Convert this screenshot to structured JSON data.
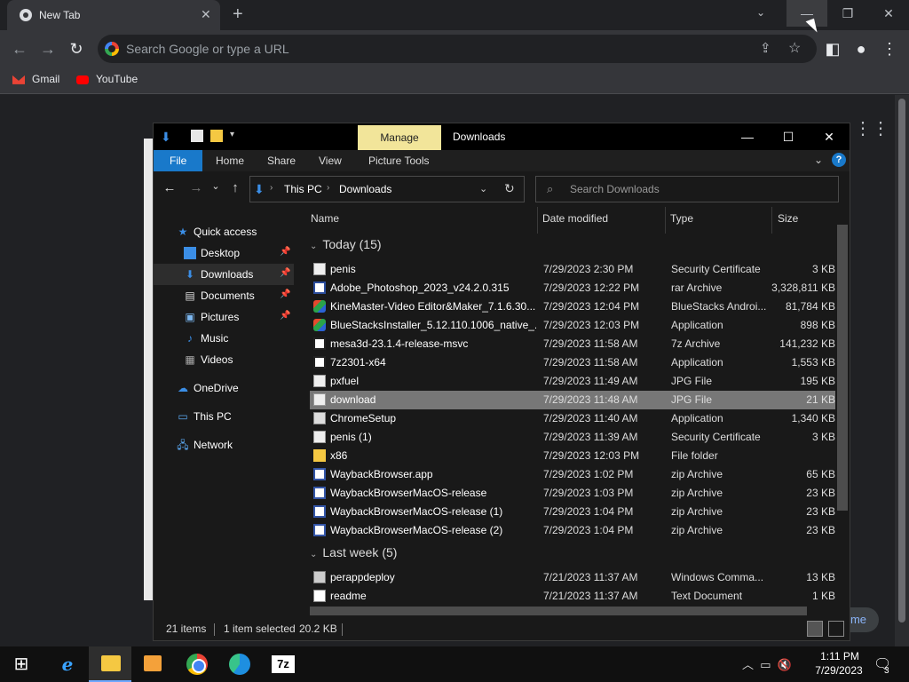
{
  "chrome": {
    "tab_title": "New Tab",
    "new_tab_symbol": "+",
    "omnibox_placeholder": "Search Google or type a URL",
    "bookmarks": [
      {
        "label": "Gmail",
        "icon": "gmail-icon"
      },
      {
        "label": "YouTube",
        "icon": "youtube-icon"
      }
    ],
    "ghost_pill_text": "me"
  },
  "explorer": {
    "title": "Downloads",
    "manage_tab": "Manage",
    "ribbon_tabs": [
      "File",
      "Home",
      "Share",
      "View",
      "Picture Tools"
    ],
    "breadcrumb": [
      "This PC",
      "Downloads"
    ],
    "search_placeholder": "Search Downloads",
    "nav": [
      {
        "label": "Quick access",
        "icon": "star-icon",
        "pinned": false
      },
      {
        "label": "Desktop",
        "icon": "desktop-icon",
        "pinned": true
      },
      {
        "label": "Downloads",
        "icon": "download-arrow-icon",
        "pinned": true,
        "selected": true
      },
      {
        "label": "Documents",
        "icon": "document-icon",
        "pinned": true
      },
      {
        "label": "Pictures",
        "icon": "picture-icon",
        "pinned": true
      },
      {
        "label": "Music",
        "icon": "music-icon",
        "pinned": false
      },
      {
        "label": "Videos",
        "icon": "video-icon",
        "pinned": false
      },
      {
        "label": "OneDrive",
        "icon": "cloud-icon",
        "pinned": false
      },
      {
        "label": "This PC",
        "icon": "computer-icon",
        "pinned": false
      },
      {
        "label": "Network",
        "icon": "network-icon",
        "pinned": false
      }
    ],
    "columns": [
      "Name",
      "Date modified",
      "Type",
      "Size"
    ],
    "groups": [
      {
        "label": "Today (15)",
        "files": [
          {
            "name": "penis",
            "date": "7/29/2023 2:30 PM",
            "type": "Security Certificate",
            "size": "3 KB",
            "icon": "cert"
          },
          {
            "name": "Adobe_Photoshop_2023_v24.2.0.315",
            "date": "7/29/2023 12:22 PM",
            "type": "rar Archive",
            "size": "3,328,811 KB",
            "icon": "rar"
          },
          {
            "name": "KineMaster-Video Editor&Maker_7.1.6.30...",
            "date": "7/29/2023 12:04 PM",
            "type": "BlueStacks Androi...",
            "size": "81,784 KB",
            "icon": "app"
          },
          {
            "name": "BlueStacksInstaller_5.12.110.1006_native_...",
            "date": "7/29/2023 12:03 PM",
            "type": "Application",
            "size": "898 KB",
            "icon": "app"
          },
          {
            "name": "mesa3d-23.1.4-release-msvc",
            "date": "7/29/2023 11:58 AM",
            "type": "7z Archive",
            "size": "141,232 KB",
            "icon": "7z"
          },
          {
            "name": "7z2301-x64",
            "date": "7/29/2023 11:58 AM",
            "type": "Application",
            "size": "1,553 KB",
            "icon": "7z"
          },
          {
            "name": "pxfuel",
            "date": "7/29/2023 11:49 AM",
            "type": "JPG File",
            "size": "195 KB",
            "icon": "jpg"
          },
          {
            "name": "download",
            "date": "7/29/2023 11:48 AM",
            "type": "JPG File",
            "size": "21 KB",
            "icon": "jpg",
            "selected": true
          },
          {
            "name": "ChromeSetup",
            "date": "7/29/2023 11:40 AM",
            "type": "Application",
            "size": "1,340 KB",
            "icon": "exe"
          },
          {
            "name": "penis (1)",
            "date": "7/29/2023 11:39 AM",
            "type": "Security Certificate",
            "size": "3 KB",
            "icon": "cert"
          },
          {
            "name": "x86",
            "date": "7/29/2023 12:03 PM",
            "type": "File folder",
            "size": "",
            "icon": "folder"
          },
          {
            "name": "WaybackBrowser.app",
            "date": "7/29/2023 1:02 PM",
            "type": "zip Archive",
            "size": "65 KB",
            "icon": "zip"
          },
          {
            "name": "WaybackBrowserMacOS-release",
            "date": "7/29/2023 1:03 PM",
            "type": "zip Archive",
            "size": "23 KB",
            "icon": "zip"
          },
          {
            "name": "WaybackBrowserMacOS-release (1)",
            "date": "7/29/2023 1:04 PM",
            "type": "zip Archive",
            "size": "23 KB",
            "icon": "zip"
          },
          {
            "name": "WaybackBrowserMacOS-release (2)",
            "date": "7/29/2023 1:04 PM",
            "type": "zip Archive",
            "size": "23 KB",
            "icon": "zip"
          }
        ]
      },
      {
        "label": "Last week (5)",
        "files": [
          {
            "name": "perappdeploy",
            "date": "7/21/2023 11:37 AM",
            "type": "Windows Comma...",
            "size": "13 KB",
            "icon": "bat"
          },
          {
            "name": "readme",
            "date": "7/21/2023 11:37 AM",
            "type": "Text Document",
            "size": "1 KB",
            "icon": "txt"
          }
        ]
      }
    ],
    "status": {
      "items": "21 items",
      "selected": "1 item selected",
      "size": "20.2 KB"
    }
  },
  "taskbar": {
    "time": "1:11 PM",
    "date": "7/29/2023",
    "notification_count": "3"
  }
}
